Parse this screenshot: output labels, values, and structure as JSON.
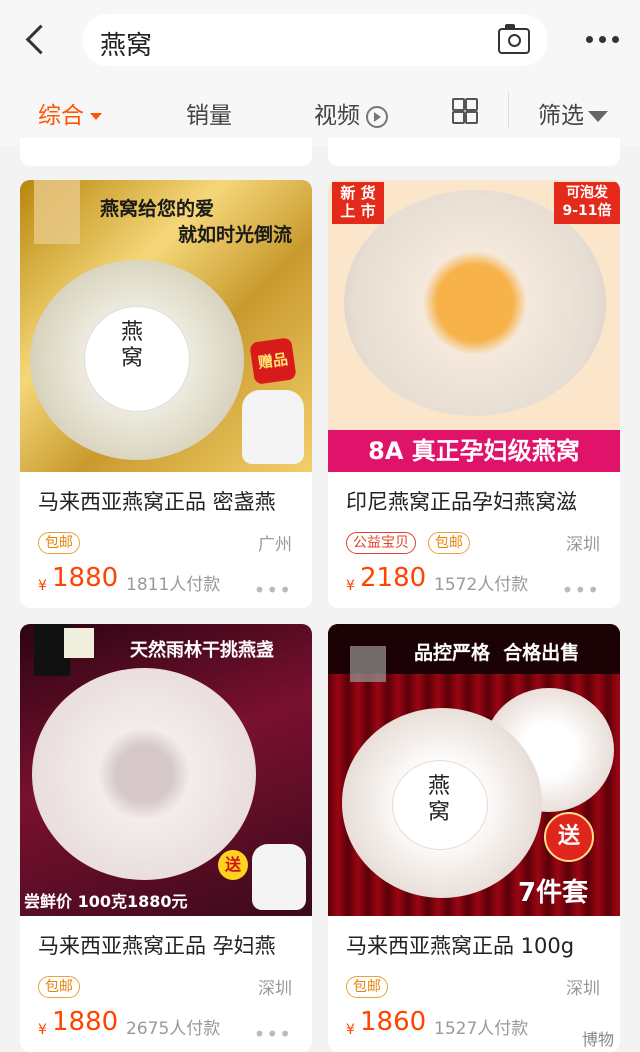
{
  "search": {
    "query": "燕窝"
  },
  "tabs": [
    {
      "label": "综合",
      "active": true
    },
    {
      "label": "销量"
    },
    {
      "label": "视频"
    },
    {
      "label": "筛选"
    }
  ],
  "cards": [
    {
      "banner_lines": [
        "燕窝给您的爱",
        "就如时光倒流"
      ],
      "badge": "赠品",
      "label_text": "燕窝",
      "title": "马来西亚燕窝正品 密盏燕",
      "tags": [
        "包邮"
      ],
      "location": "广州",
      "currency": "¥",
      "price": "1880",
      "paid": "1811人付款"
    },
    {
      "corner_left": [
        "新 货",
        "上 市"
      ],
      "corner_right": [
        "可泡发",
        "9-11倍"
      ],
      "bottom_banner": "8A 真正孕妇级燕窝",
      "title": "印尼燕窝正品孕妇燕窝滋",
      "tags": [
        "公益宝贝",
        "包邮"
      ],
      "location": "深圳",
      "currency": "¥",
      "price": "2180",
      "paid": "1572人付款"
    },
    {
      "banner_top": "天然雨林干挑燕盏",
      "bottom_banner": "尝鲜价 100克1880元",
      "badge": "送",
      "title": "马来西亚燕窝正品 孕妇燕",
      "tags": [
        "包邮"
      ],
      "location": "深圳",
      "currency": "¥",
      "price": "1880",
      "paid": "2675人付款"
    },
    {
      "banner_top": "品控严格  合格出售",
      "label_text": "燕窝",
      "badge": "送",
      "bottom_text": "7件套",
      "title": "马来西亚燕窝正品 100g",
      "tags": [
        "包邮"
      ],
      "location": "深圳",
      "currency": "¥",
      "price": "1860",
      "paid": "1527人付款"
    }
  ],
  "watermark": "博物",
  "colors": {
    "accent": "#ff5500",
    "price": "#ff4400",
    "tag": "#e8830a"
  }
}
